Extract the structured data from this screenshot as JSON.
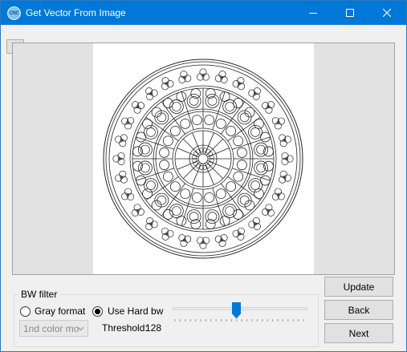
{
  "window": {
    "title": "Get Vector From Image",
    "icon_text": "CNC",
    "icon": "app-logo-icon",
    "controls": [
      "minimize-icon",
      "maximize-icon",
      "close-icon"
    ]
  },
  "canvas": {
    "zoom_label": "+",
    "image": "mandala-rose-window-line-art"
  },
  "bw_filter": {
    "title": "BW filter",
    "gray_format_label": "Gray format",
    "gray_format_checked": false,
    "hard_bw_label": "Use Hard bw",
    "hard_bw_checked": true,
    "color_mode_select": "1nd color mo",
    "threshold_label": "Threshold:",
    "threshold_value": "128",
    "slider_fraction": 0.5
  },
  "buttons": {
    "update": "Update",
    "back": "Back",
    "next": "Next"
  },
  "colors": {
    "titlebar": "#0078d7",
    "slider_thumb": "#0078d7"
  }
}
